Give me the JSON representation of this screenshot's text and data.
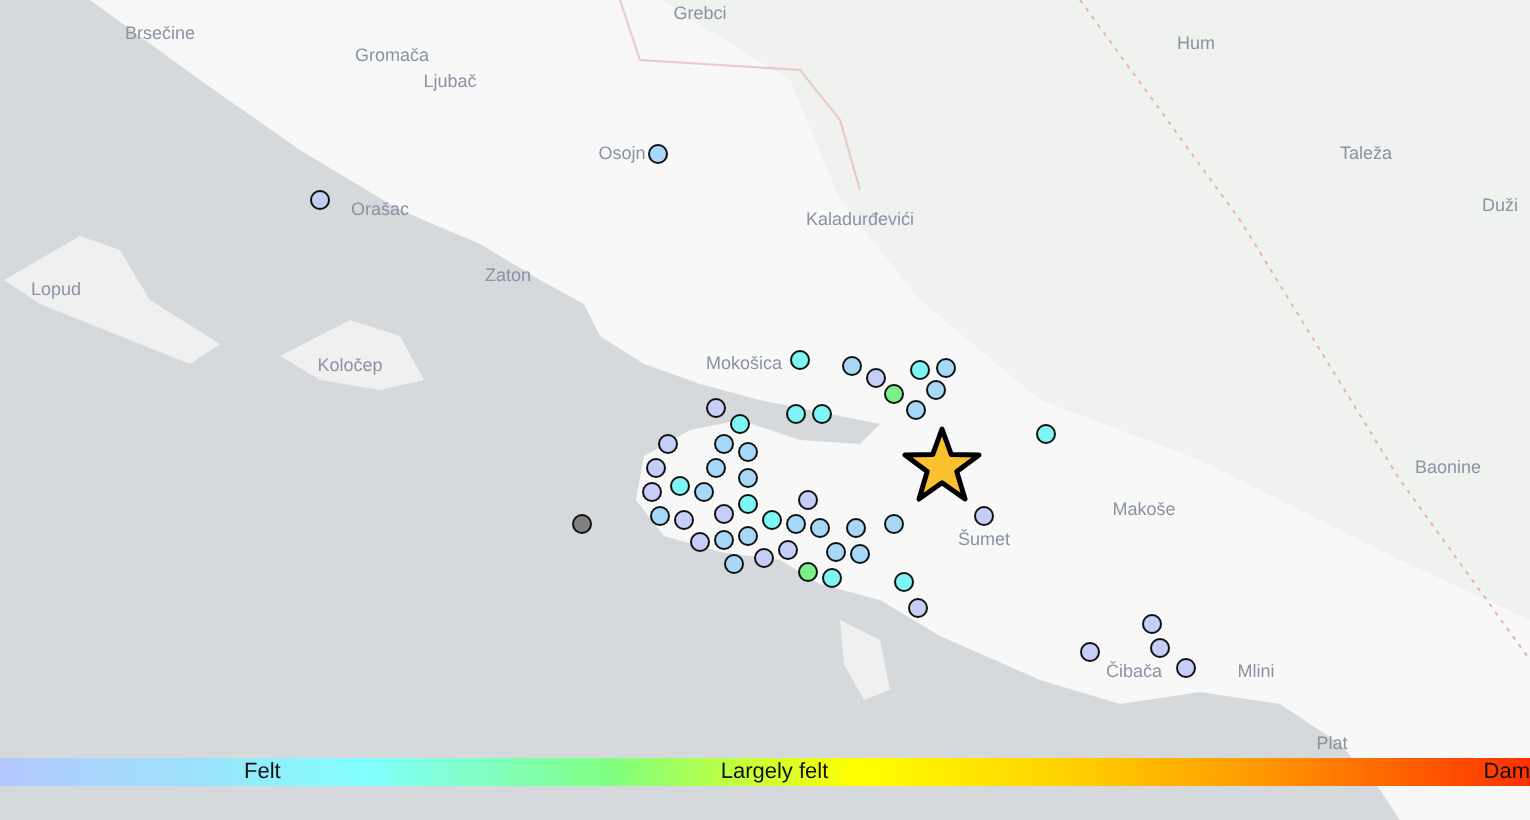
{
  "map": {
    "place_labels": [
      {
        "name": "Grebci"
      },
      {
        "name": "Brsečine"
      },
      {
        "name": "Gromača"
      },
      {
        "name": "Hum"
      },
      {
        "name": "Ljubač"
      },
      {
        "name": "Osojn"
      },
      {
        "name": "Taleža"
      },
      {
        "name": "Orašac"
      },
      {
        "name": "Kaladurđevići"
      },
      {
        "name": "Duži"
      },
      {
        "name": "Zaton"
      },
      {
        "name": "Lopud"
      },
      {
        "name": "Koločep"
      },
      {
        "name": "Mokošica"
      },
      {
        "name": "Baonine"
      },
      {
        "name": "Makoše"
      },
      {
        "name": "Šumet"
      },
      {
        "name": "Čibača"
      },
      {
        "name": "Mlini"
      },
      {
        "name": "Plat"
      }
    ],
    "felt_reports": [
      {
        "color": "#c6cdf7"
      },
      {
        "color": "#a8d8f8"
      },
      {
        "color": "#7ff4f4"
      },
      {
        "color": "#a8d8f8"
      },
      {
        "color": "#c6cdf7"
      },
      {
        "color": "#7ef08a"
      },
      {
        "color": "#7ff4f4"
      },
      {
        "color": "#a8d8f8"
      },
      {
        "color": "#a8d8f8"
      },
      {
        "color": "#a8d8f8"
      },
      {
        "color": "#7ff4f4"
      },
      {
        "color": "#7ff4f4"
      },
      {
        "color": "#c6cdf7"
      },
      {
        "color": "#7ff4f4"
      },
      {
        "color": "#a8d8f8"
      },
      {
        "color": "#c6cdf7"
      },
      {
        "color": "#7ff4f4"
      },
      {
        "color": "#c6cdf7"
      },
      {
        "color": "#c6cdf7"
      },
      {
        "color": "#c6cdf7"
      },
      {
        "color": "#c6cdf7"
      },
      {
        "color": "#c6cdf7"
      },
      {
        "color": "#808080"
      },
      {
        "color": "#c6cdf7"
      },
      {
        "color": "#c6cdf7"
      },
      {
        "color": "#7ff4f4"
      },
      {
        "color": "#a8d8f8"
      },
      {
        "color": "#a8d8f8"
      },
      {
        "color": "#7ff4f4"
      },
      {
        "color": "#a8d8f8"
      },
      {
        "color": "#a8d8f8"
      },
      {
        "color": "#c6cdf7"
      },
      {
        "color": "#7ff4f4"
      },
      {
        "color": "#7ff4f4"
      },
      {
        "color": "#a8d8f8"
      },
      {
        "color": "#c6cdf7"
      },
      {
        "color": "#c6cdf7"
      },
      {
        "color": "#a8d8f8"
      },
      {
        "color": "#a8d8f8"
      },
      {
        "color": "#a8d8f8"
      },
      {
        "color": "#a8d8f8"
      },
      {
        "color": "#c6cdf7"
      },
      {
        "color": "#a8d8f8"
      },
      {
        "color": "#c6cdf7"
      },
      {
        "color": "#c6cdf7"
      },
      {
        "color": "#7ef08a"
      },
      {
        "color": "#7ff4f4"
      },
      {
        "color": "#a8d8f8"
      },
      {
        "color": "#a8d8f8"
      },
      {
        "color": "#a8d8f8"
      },
      {
        "color": "#a8d8f8"
      },
      {
        "color": "#c6cdf7"
      }
    ]
  },
  "legend": {
    "labels": [
      "Felt",
      "Largely felt",
      "Dam"
    ]
  }
}
